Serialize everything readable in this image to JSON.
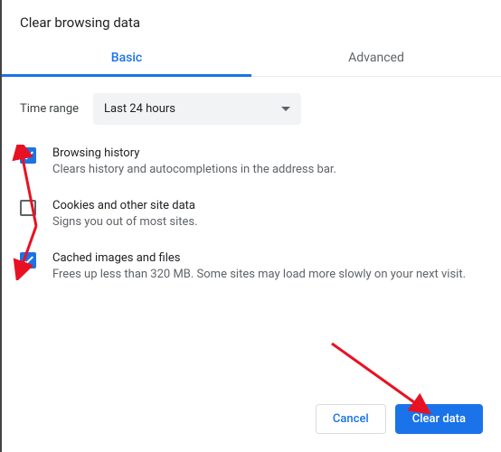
{
  "title": "Clear browsing data",
  "tabs": {
    "basic": "Basic",
    "advanced": "Advanced"
  },
  "timerange": {
    "label": "Time range",
    "value": "Last 24 hours"
  },
  "items": [
    {
      "checked": true,
      "title": "Browsing history",
      "desc": "Clears history and autocompletions in the address bar."
    },
    {
      "checked": false,
      "title": "Cookies and other site data",
      "desc": "Signs you out of most sites."
    },
    {
      "checked": true,
      "title": "Cached images and files",
      "desc": "Frees up less than 320 MB. Some sites may load more slowly on your next visit."
    }
  ],
  "buttons": {
    "cancel": "Cancel",
    "clear": "Clear data"
  }
}
